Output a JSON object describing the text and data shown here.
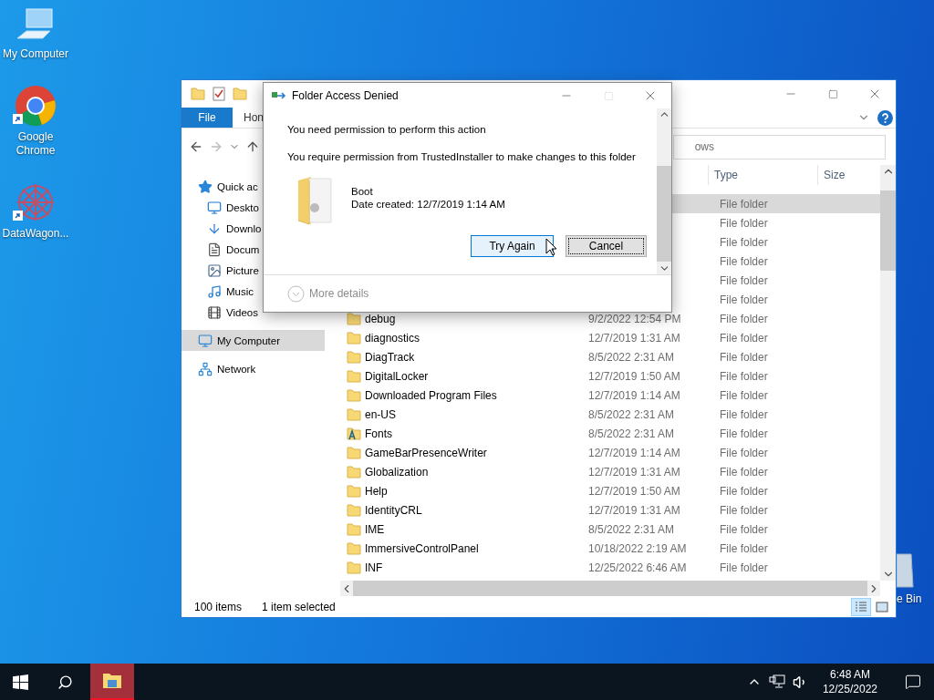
{
  "desktop_icons": [
    {
      "label": "My Computer",
      "kind": "computer",
      "shortcut": false
    },
    {
      "label": "Google Chrome",
      "kind": "chrome",
      "shortcut": true
    },
    {
      "label": "DataWagon...",
      "kind": "app",
      "shortcut": true
    }
  ],
  "recycle_bin": {
    "label": "e Bin"
  },
  "explorer": {
    "ribbon_tabs": [
      {
        "label": "File",
        "kind": "file"
      },
      {
        "label": "Hon",
        "kind": "tab"
      }
    ],
    "search": {
      "placeholder": "ows"
    },
    "nav_items": [
      {
        "label": "Quick ac",
        "kind": "star",
        "selected": false,
        "children": [
          {
            "label": "Deskto",
            "kind": "desktop",
            "selected": false
          },
          {
            "label": "Downlo",
            "kind": "download",
            "selected": false
          },
          {
            "label": "Docum",
            "kind": "document",
            "selected": false
          },
          {
            "label": "Picture",
            "kind": "picture",
            "selected": false
          },
          {
            "label": "Music",
            "kind": "music",
            "selected": false
          },
          {
            "label": "Videos",
            "kind": "video",
            "selected": false
          }
        ]
      },
      {
        "label": "My Computer",
        "kind": "computer",
        "selected": true
      },
      {
        "label": "Network",
        "kind": "network",
        "selected": false
      }
    ],
    "columns": [
      "Type",
      "Size"
    ],
    "rows": [
      {
        "type": "File folder",
        "selected": true
      },
      {
        "type": "File folder",
        "selected": false
      },
      {
        "type": "File folder",
        "selected": false
      },
      {
        "type": "File folder",
        "selected": false
      },
      {
        "type": "File folder",
        "selected": false
      },
      {
        "type": "File folder",
        "selected": false
      },
      {
        "name": "debug",
        "date": "9/2/2022 12:54 PM",
        "type": "File folder",
        "kind": "folder",
        "selected": false
      },
      {
        "name": "diagnostics",
        "date": "12/7/2019 1:31 AM",
        "type": "File folder",
        "kind": "folder",
        "selected": false
      },
      {
        "name": "DiagTrack",
        "date": "8/5/2022 2:31 AM",
        "type": "File folder",
        "kind": "folder",
        "selected": false
      },
      {
        "name": "DigitalLocker",
        "date": "12/7/2019 1:50 AM",
        "type": "File folder",
        "kind": "folder",
        "selected": false
      },
      {
        "name": "Downloaded Program Files",
        "date": "12/7/2019 1:14 AM",
        "type": "File folder",
        "kind": "folder",
        "selected": false
      },
      {
        "name": "en-US",
        "date": "8/5/2022 2:31 AM",
        "type": "File folder",
        "kind": "folder",
        "selected": false
      },
      {
        "name": "Fonts",
        "date": "8/5/2022 2:31 AM",
        "type": "File folder",
        "kind": "fonts",
        "selected": false
      },
      {
        "name": "GameBarPresenceWriter",
        "date": "12/7/2019 1:14 AM",
        "type": "File folder",
        "kind": "folder",
        "selected": false
      },
      {
        "name": "Globalization",
        "date": "12/7/2019 1:31 AM",
        "type": "File folder",
        "kind": "folder",
        "selected": false
      },
      {
        "name": "Help",
        "date": "12/7/2019 1:50 AM",
        "type": "File folder",
        "kind": "folder",
        "selected": false
      },
      {
        "name": "IdentityCRL",
        "date": "12/7/2019 1:31 AM",
        "type": "File folder",
        "kind": "folder",
        "selected": false
      },
      {
        "name": "IME",
        "date": "8/5/2022 2:31 AM",
        "type": "File folder",
        "kind": "folder",
        "selected": false
      },
      {
        "name": "ImmersiveControlPanel",
        "date": "10/18/2022 2:19 AM",
        "type": "File folder",
        "kind": "folder",
        "selected": false
      },
      {
        "name": "INF",
        "date": "12/25/2022 6:46 AM",
        "type": "File folder",
        "kind": "folder",
        "selected": false
      }
    ],
    "status": {
      "count": "100 items",
      "selection": "1 item selected"
    },
    "views": [
      {
        "kind": "details",
        "selected": true
      },
      {
        "kind": "tiles",
        "selected": false
      }
    ]
  },
  "dialog": {
    "title": "Folder Access Denied",
    "maximize_disabled": true,
    "message": "You need permission to perform this action",
    "detail": "You require permission from TrustedInstaller to make changes to this folder",
    "item_name": "Boot",
    "item_date": "Date created: 12/7/2019 1:14 AM",
    "buttons": [
      {
        "label": "Try Again",
        "default": true,
        "focused": false
      },
      {
        "label": "Cancel",
        "default": false,
        "focused": true
      }
    ],
    "more": "More details"
  },
  "taskbar": {
    "apps": [
      {
        "kind": "explorer",
        "selected": true
      }
    ],
    "time": "6:48 AM",
    "date": "12/25/2022"
  }
}
